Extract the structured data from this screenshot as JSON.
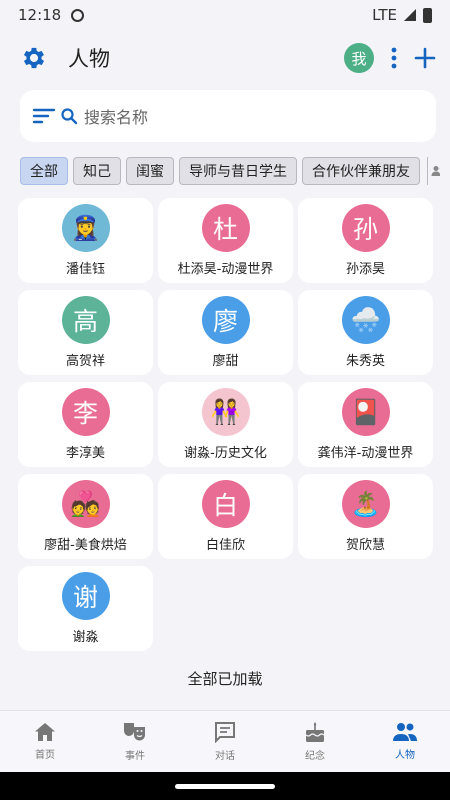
{
  "status": {
    "time": "12:18",
    "network": "LTE"
  },
  "app_bar": {
    "title": "人物",
    "avatar_text": "我"
  },
  "search": {
    "placeholder": "搜索名称"
  },
  "filters": {
    "chips": [
      "全部",
      "知己",
      "闺蜜",
      "导师与昔日学生",
      "合作伙伴兼朋友"
    ],
    "active": "全部",
    "count": "13"
  },
  "people": [
    {
      "name": "潘佳钰",
      "avatar": "👮‍♀️",
      "type": "emoji",
      "color": "#6fb8d6"
    },
    {
      "name": "杜添昊-动漫世界",
      "avatar": "杜",
      "type": "text",
      "color": "#e96c94"
    },
    {
      "name": "孙添昊",
      "avatar": "孙",
      "type": "text",
      "color": "#e96c94"
    },
    {
      "name": "高贺祥",
      "avatar": "高",
      "type": "text",
      "color": "#5cb398"
    },
    {
      "name": "廖甜",
      "avatar": "廖",
      "type": "text",
      "color": "#4a9ee8"
    },
    {
      "name": "朱秀英",
      "avatar": "🌨️",
      "type": "emoji",
      "color": "#4a9ee8"
    },
    {
      "name": "李淳美",
      "avatar": "李",
      "type": "text",
      "color": "#e96c94"
    },
    {
      "name": "谢淼-历史文化",
      "avatar": "👭",
      "type": "emoji",
      "color": "#f4c5cf"
    },
    {
      "name": "龚伟洋-动漫世界",
      "avatar": "🎴",
      "type": "emoji",
      "color": "#e96c94"
    },
    {
      "name": "廖甜-美食烘焙",
      "avatar": "💑",
      "type": "emoji",
      "color": "#e96c94"
    },
    {
      "name": "白佳欣",
      "avatar": "白",
      "type": "text",
      "color": "#e96c94"
    },
    {
      "name": "贺欣慧",
      "avatar": "🏝️",
      "type": "emoji",
      "color": "#e96c94"
    },
    {
      "name": "谢淼",
      "avatar": "谢",
      "type": "text",
      "color": "#4a9ee8"
    }
  ],
  "footer_text": "全部已加载",
  "nav": [
    {
      "label": "首页",
      "icon": "home-icon",
      "active": false
    },
    {
      "label": "事件",
      "icon": "theater-icon",
      "active": false
    },
    {
      "label": "对话",
      "icon": "chat-icon",
      "active": false
    },
    {
      "label": "纪念",
      "icon": "cake-icon",
      "active": false
    },
    {
      "label": "人物",
      "icon": "people-icon",
      "active": true
    }
  ],
  "colors": {
    "accent": "#1565c0",
    "background": "#f4f3f8"
  }
}
